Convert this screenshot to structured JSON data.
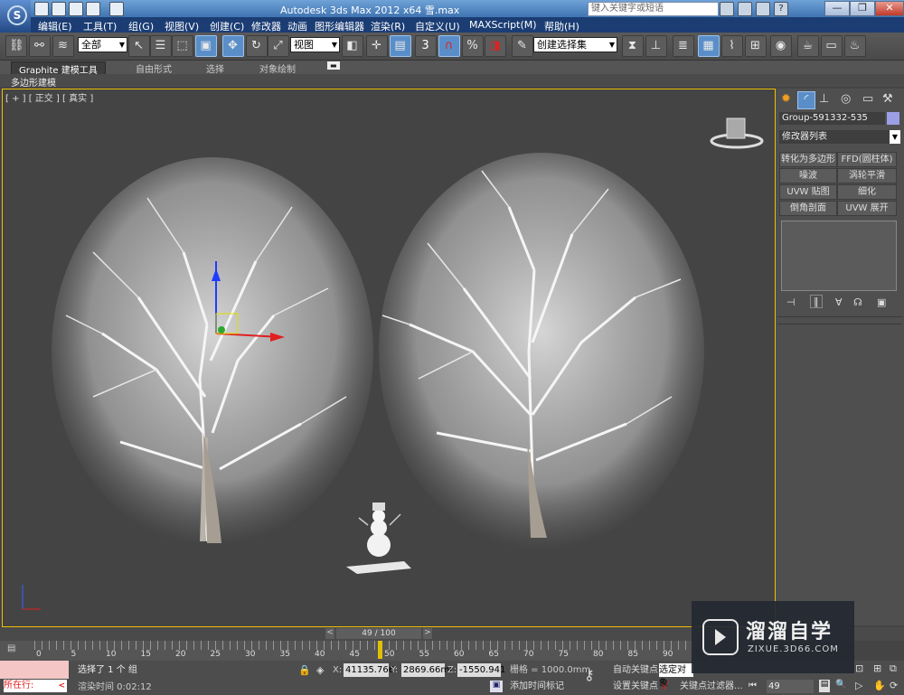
{
  "window": {
    "title": "Autodesk 3ds Max  2012 x64      雪.max",
    "search_placeholder": "键入关键字或短语",
    "help_icon": "?",
    "win_min": "—",
    "win_max": "❐",
    "win_close": "✕"
  },
  "menu": [
    "编辑(E)",
    "工具(T)",
    "组(G)",
    "视图(V)",
    "创建(C)",
    "修改器",
    "动画",
    "图形编辑器",
    "渲染(R)",
    "自定义(U)",
    "MAXScript(M)",
    "帮助(H)"
  ],
  "toolbar": {
    "filter_value": "全部",
    "ref_coord_value": "视图",
    "snap_num": "3",
    "named_selection_value": "创建选择集"
  },
  "ribbon": {
    "tabs": [
      "Graphite 建模工具",
      "自由形式",
      "选择",
      "对象绘制"
    ],
    "sub_label": "多边形建模"
  },
  "viewport": {
    "label": "[ + ] [ 正交 ] [ 真实 ]"
  },
  "command_panel": {
    "object_name": "Group-591332-535",
    "modifier_list": "修改器列表",
    "buttons": [
      "转化为多边形",
      "FFD(圆柱体)",
      "噪波",
      "涡轮平滑",
      "UVW 贴图",
      "细化",
      "倒角剖面",
      "UVW 展开"
    ],
    "color_swatch": "#9b9fe6"
  },
  "timeline": {
    "frame_label": "49 / 100",
    "ticks": [
      "0",
      "5",
      "10",
      "15",
      "20",
      "25",
      "30",
      "35",
      "40",
      "45",
      "50",
      "55",
      "60",
      "65",
      "70",
      "75",
      "80",
      "85",
      "90"
    ]
  },
  "status": {
    "script_label": "所在行:",
    "selection": "选择了 1 个 组",
    "render_time_label": "渲染时间  0:02:12",
    "x_label": "X:",
    "x_value": "41135.766",
    "y_label": "Y:",
    "y_value": "2869.66mr",
    "z_label": "Z:",
    "z_value": "-1550.941",
    "grid": "栅格 = 1000.0mm",
    "add_tag": "添加时间标记",
    "auto_key": "自动关键点",
    "set_key": "设置关键点",
    "selected": "选定对象",
    "key_filters": "关键点过滤器...",
    "frame_value": "49"
  },
  "watermark": {
    "brand_cn": "溜溜自学",
    "brand_url": "ZIXUE.3D66.COM"
  },
  "colors": {
    "menu_bar": "#1b3d74",
    "viewport_bg": "#444444",
    "viewport_border": "#f0c000",
    "active_button": "#5a8ec8",
    "accent_red": "#e02020"
  }
}
